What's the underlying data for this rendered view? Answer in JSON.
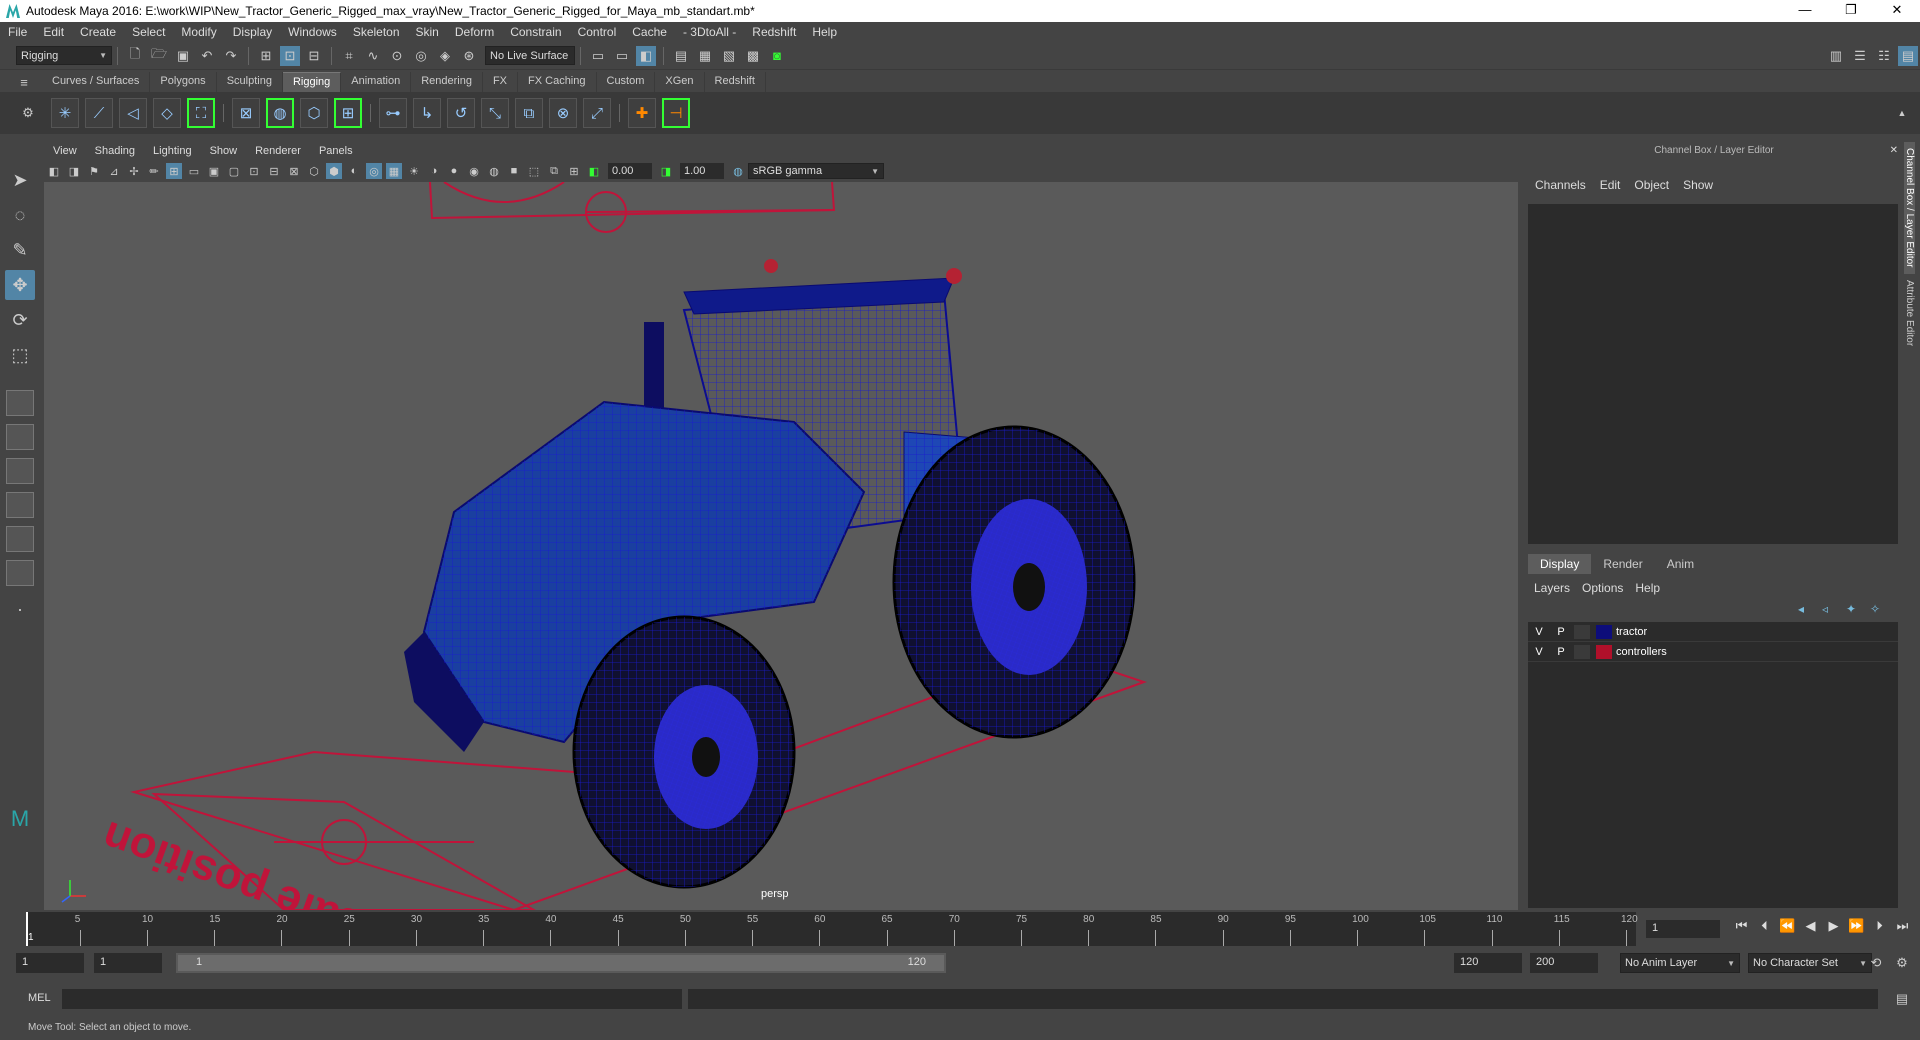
{
  "titlebar": {
    "title": "Autodesk Maya 2016: E:\\work\\WIP\\New_Tractor_Generic_Rigged_max_vray\\New_Tractor_Generic_Rigged_for_Maya_mb_standart.mb*",
    "minimize": "—",
    "maximize": "❐",
    "close": "✕"
  },
  "menu": [
    "File",
    "Edit",
    "Create",
    "Select",
    "Modify",
    "Display",
    "Windows",
    "Skeleton",
    "Skin",
    "Deform",
    "Constrain",
    "Control",
    "Cache",
    "- 3DtoAll -",
    "Redshift",
    "Help"
  ],
  "statusline": {
    "menuset": "Rigging",
    "live_surface": "No Live Surface"
  },
  "shelf": {
    "tabs": [
      "Curves / Surfaces",
      "Polygons",
      "Sculpting",
      "Rigging",
      "Animation",
      "Rendering",
      "FX",
      "FX Caching",
      "Custom",
      "XGen",
      "Redshift"
    ],
    "active_tab": "Rigging"
  },
  "viewport": {
    "menu": [
      "View",
      "Shading",
      "Lighting",
      "Show",
      "Renderer",
      "Panels"
    ],
    "exposure": "0.00",
    "gamma": "1.00",
    "colorspace": "sRGB gamma",
    "camera": "persp",
    "ground_text": "safe position"
  },
  "channel_box": {
    "title": "Channel Box / Layer Editor",
    "menu": [
      "Channels",
      "Edit",
      "Object",
      "Show"
    ],
    "layer_tabs": [
      "Display",
      "Render",
      "Anim"
    ],
    "active_layer_tab": "Display",
    "layer_menu": [
      "Layers",
      "Options",
      "Help"
    ],
    "layers": [
      {
        "v": "V",
        "p": "P",
        "name": "tractor",
        "color": "#0d0d7a"
      },
      {
        "v": "V",
        "p": "P",
        "name": "controllers",
        "color": "#b0102a"
      }
    ]
  },
  "side_tabs": [
    "Channel Box / Layer Editor",
    "Attribute Editor"
  ],
  "timeline": {
    "ticks": [
      "5",
      "10",
      "15",
      "20",
      "25",
      "30",
      "35",
      "40",
      "45",
      "50",
      "55",
      "60",
      "65",
      "70",
      "75",
      "80",
      "85",
      "90",
      "95",
      "100",
      "105",
      "110",
      "115",
      "120"
    ],
    "current_frame_label": "1",
    "current_frame": "1"
  },
  "range": {
    "start": "1",
    "start_inner": "1",
    "slider_start": "1",
    "slider_end": "120",
    "end_inner": "120",
    "end": "200",
    "anim_layer": "No Anim Layer",
    "character_set": "No Character Set"
  },
  "command": {
    "label": "MEL"
  },
  "help_line": "Move Tool: Select an object to move."
}
